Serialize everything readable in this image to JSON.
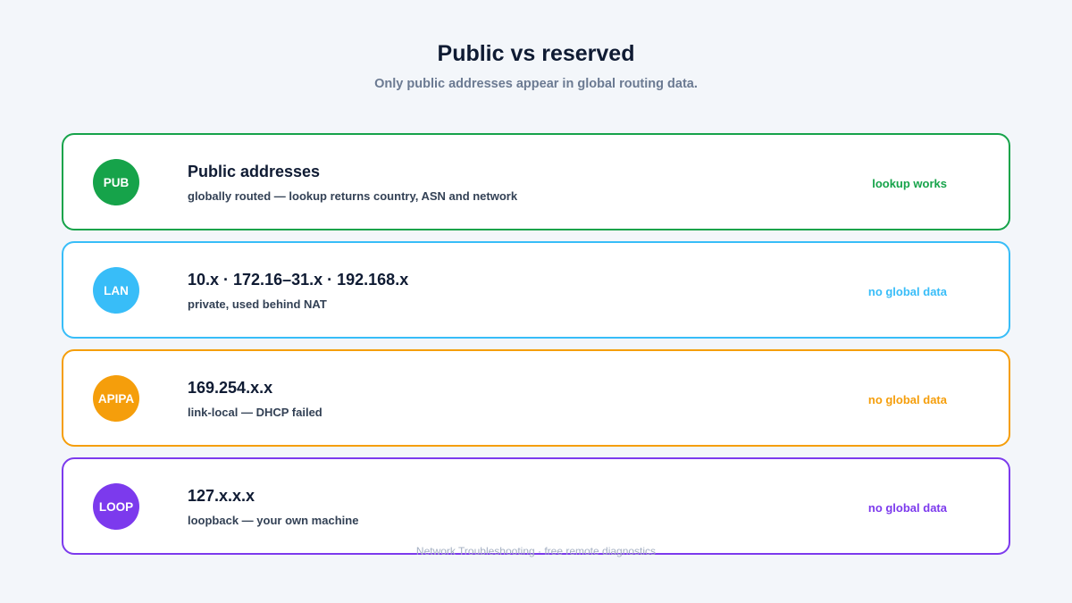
{
  "header": {
    "title": "Public vs reserved",
    "subtitle": "Only public addresses appear in global routing data."
  },
  "cards": [
    {
      "badge": "PUB",
      "title": "Public addresses",
      "description": "globally routed — lookup returns country, ASN and network",
      "status": "lookup works",
      "color": "#16a34a"
    },
    {
      "badge": "LAN",
      "title": "10.x · 172.16–31.x · 192.168.x",
      "description": "private, used behind NAT",
      "status": "no global data",
      "color": "#38bdf8"
    },
    {
      "badge": "APIPA",
      "title": "169.254.x.x",
      "description": "link-local — DHCP failed",
      "status": "no global data",
      "color": "#f59e0b"
    },
    {
      "badge": "LOOP",
      "title": "127.x.x.x",
      "description": "loopback — your own machine",
      "status": "no global data",
      "color": "#7c3aed"
    }
  ],
  "footer": {
    "text": "Network Troubleshooting · free remote diagnostics"
  }
}
